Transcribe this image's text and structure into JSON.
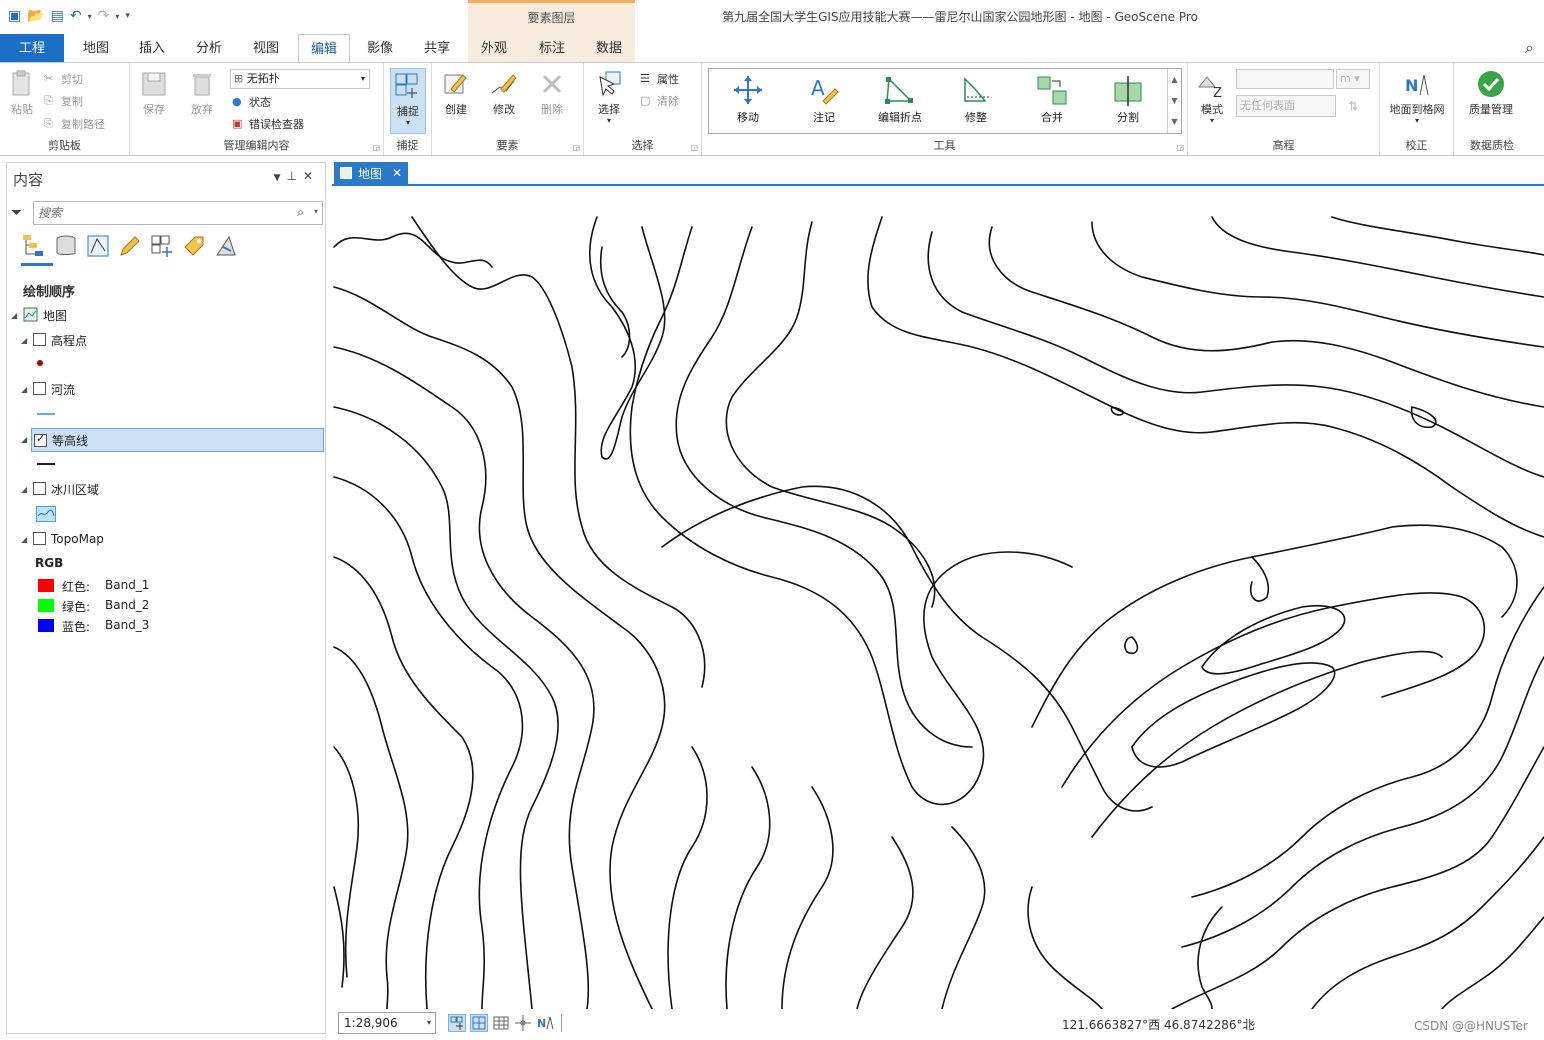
{
  "window": {
    "title": "第九届全国大学生GIS应用技能大赛——雷尼尔山国家公园地形图 - 地图 - GeoScene Pro",
    "context_tab_group": "要素图层"
  },
  "quick_access": [
    "new-icon",
    "open-icon",
    "save-icon",
    "undo-icon",
    "redo-icon",
    "customize-icon"
  ],
  "tabs": [
    "工程",
    "地图",
    "插入",
    "分析",
    "视图",
    "编辑",
    "影像",
    "共享",
    "外观",
    "标注",
    "数据"
  ],
  "active_tab": "编辑",
  "ribbon": {
    "clipboard": {
      "title": "剪贴板",
      "paste": "粘贴",
      "cut": "剪切",
      "copy": "复制",
      "copy_path": "复制路径"
    },
    "manage": {
      "title": "管理编辑内容",
      "save": "保存",
      "discard": "放弃",
      "topology": "无拓扑",
      "status": "状态",
      "error_inspector": "错误检查器"
    },
    "snapping": {
      "title": "捕捉",
      "snap": "捕捉"
    },
    "features": {
      "title": "要素",
      "create": "创建",
      "modify": "修改",
      "delete": "删除"
    },
    "selection": {
      "title": "选择",
      "select": "选择",
      "attributes": "属性",
      "clear": "清除"
    },
    "tools": {
      "title": "工具",
      "move": "移动",
      "annotate": "注记",
      "edit_vertices": "编辑折点",
      "reshape": "修整",
      "merge": "合并",
      "split": "分割"
    },
    "elevation": {
      "title": "高程",
      "mode": "模式",
      "unit": "m",
      "surface": "无任何表面"
    },
    "georef": {
      "title": "校正",
      "ground_to_grid": "地面到格网"
    },
    "quality": {
      "title": "数据质检",
      "manage": "质量管理"
    }
  },
  "contents": {
    "title": "内容",
    "search_placeholder": "搜索",
    "drawing_order": "绘制顺序",
    "map_name": "地图",
    "layers": [
      {
        "name": "高程点",
        "checked": false
      },
      {
        "name": "河流",
        "checked": false
      },
      {
        "name": "等高线",
        "checked": true
      },
      {
        "name": "冰川区域",
        "checked": false
      },
      {
        "name": "TopoMap",
        "checked": false
      }
    ],
    "rgb_label": "RGB",
    "bands": [
      {
        "channel": "红色:",
        "band": "Band_1",
        "color": "#ff0000"
      },
      {
        "channel": "绿色:",
        "band": "Band_2",
        "color": "#00ff00"
      },
      {
        "channel": "蓝色:",
        "band": "Band_3",
        "color": "#0000ff"
      }
    ]
  },
  "map": {
    "tab_label": "地图",
    "scale": "1:28,906",
    "coordinates": "121.6663827°西 46.8742286°北"
  },
  "watermark": "CSDN @@HNUSTer",
  "colors": {
    "accent": "#2b79c9",
    "project_tab": "#1b6fc4",
    "selected_row": "#cce0f5"
  }
}
